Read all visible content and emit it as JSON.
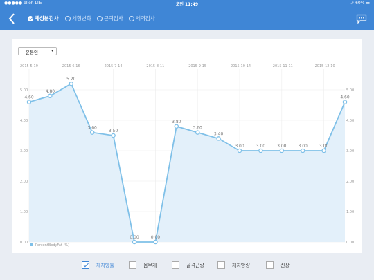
{
  "status": {
    "carrier": "●●●●● olleh  LTE",
    "time": "오전 11:49",
    "battery": "⇗ 60% ▬"
  },
  "tabs": [
    {
      "label": "체성분검사",
      "active": true
    },
    {
      "label": "체형변화",
      "active": false
    },
    {
      "label": "근력검사",
      "active": false
    },
    {
      "label": "체력검사",
      "active": false
    }
  ],
  "selector": {
    "value": "운동인"
  },
  "chart_data": {
    "type": "line",
    "x": [
      "2015-5-19",
      "",
      "2015-6-16",
      "",
      "2015-7-14",
      "",
      "2015-8-11",
      "",
      "2015-9-15",
      "",
      "2015-10-14",
      "",
      "2015-11-11",
      "",
      "2015-12-10",
      ""
    ],
    "tick_labels": [
      "2015-5-19",
      "2015-6-16",
      "2015-7-14",
      "2015-8-11",
      "2015-9-15",
      "2015-10-14",
      "2015-11-11",
      "2015-12-10"
    ],
    "y_ticks": [
      "0.00",
      "1.00",
      "2.00",
      "3.00",
      "4.00",
      "5.00"
    ],
    "ylim": [
      0,
      5.5
    ],
    "series": [
      {
        "name": "PercentBodyFat (%)",
        "values": [
          4.6,
          4.8,
          5.2,
          3.6,
          3.5,
          0.0,
          0.0,
          3.8,
          3.6,
          3.4,
          3.0,
          3.0,
          3.0,
          3.0,
          3.0,
          4.6
        ],
        "labels": [
          "4.60",
          "4.80",
          "5.20",
          "3.60",
          "3.50",
          "0.00",
          "0.00",
          "3.80",
          "3.60",
          "3.40",
          "3.00",
          "3.00",
          "3.00",
          "3.00",
          "3.00",
          "4.60"
        ]
      }
    ],
    "colors": {
      "line": "#7fc0e8",
      "fill": "#e3f0fa"
    },
    "grid": true,
    "legend": "bottom-left"
  },
  "checkboxes": [
    {
      "label": "체지방률",
      "checked": true
    },
    {
      "label": "몸무게",
      "checked": false
    },
    {
      "label": "골격근량",
      "checked": false
    },
    {
      "label": "체지방량",
      "checked": false
    },
    {
      "label": "신장",
      "checked": false
    }
  ]
}
